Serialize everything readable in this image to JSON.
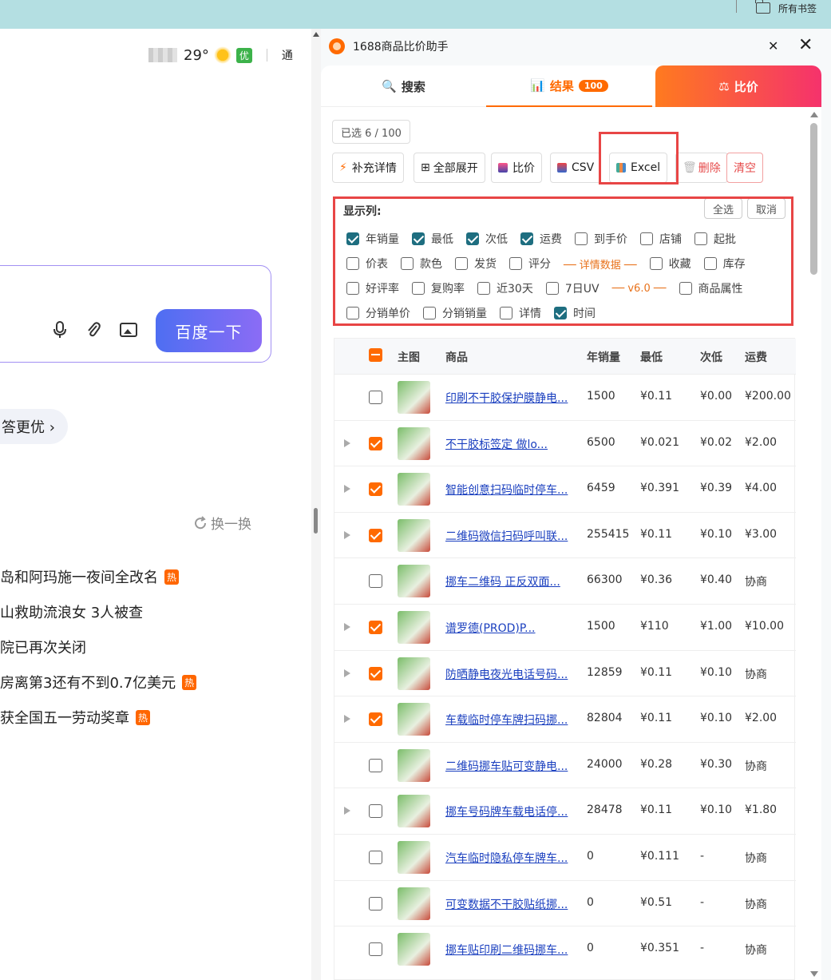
{
  "browser": {
    "bookmarks_label": "所有书签"
  },
  "baidu": {
    "temperature": "29°",
    "air_quality": "优",
    "top_right_text": "通",
    "search_button": "百度一下",
    "answer_chip": "答更优 ›",
    "refresh_label": "换一换",
    "hot_list": [
      {
        "text": "岛和阿玛施一夜间全改名",
        "hot": true
      },
      {
        "text": "山救助流浪女 3人被查",
        "hot": false
      },
      {
        "text": "院已再次关闭",
        "hot": false
      },
      {
        "text": "房离第3还有不到0.7亿美元",
        "hot": true
      },
      {
        "text": "获全国五一劳动奖章",
        "hot": true
      }
    ],
    "hot_badge": "热"
  },
  "panel": {
    "title": "1688商品比价助手",
    "tabs": {
      "search": "搜索",
      "result": "结果",
      "result_count": "100",
      "compare": "比价"
    },
    "selected_count": "已选 6 / 100",
    "toolbar": {
      "fill_details": "补充详情",
      "expand_all": "全部展开",
      "compare": "比价",
      "csv": "CSV",
      "excel": "Excel",
      "delete": "删除",
      "clear": "清空"
    },
    "columns": {
      "title": "显示列:",
      "select_all": "全选",
      "cancel": "取消",
      "row1": [
        {
          "label": "年销量",
          "checked": true
        },
        {
          "label": "最低",
          "checked": true
        },
        {
          "label": "次低",
          "checked": true
        },
        {
          "label": "运费",
          "checked": true
        },
        {
          "label": "到手价",
          "checked": false
        },
        {
          "label": "店铺",
          "checked": false
        },
        {
          "label": "起批",
          "checked": false
        }
      ],
      "row2": [
        {
          "label": "价表",
          "checked": false
        },
        {
          "label": "款色",
          "checked": false
        },
        {
          "label": "发货",
          "checked": false
        },
        {
          "label": "评分",
          "checked": false
        }
      ],
      "row2_sep": "── 详情数据 ──",
      "row2b": [
        {
          "label": "收藏",
          "checked": false
        },
        {
          "label": "库存",
          "checked": false
        }
      ],
      "row3": [
        {
          "label": "好评率",
          "checked": false
        },
        {
          "label": "复购率",
          "checked": false
        },
        {
          "label": "近30天",
          "checked": false
        },
        {
          "label": "7日UV",
          "checked": false
        }
      ],
      "row3_sep": "── v6.0 ──",
      "row3b": [
        {
          "label": "商品属性",
          "checked": false
        }
      ],
      "row4": [
        {
          "label": "分销单价",
          "checked": false
        },
        {
          "label": "分销销量",
          "checked": false
        },
        {
          "label": "详情",
          "checked": false
        },
        {
          "label": "时间",
          "checked": true
        }
      ]
    },
    "table": {
      "headers": {
        "image": "主图",
        "product": "商品",
        "sales": "年销量",
        "lowest": "最低",
        "second": "次低",
        "shipping": "运费"
      },
      "rows": [
        {
          "expand": false,
          "checked": false,
          "name": "印刷不干胶保护膜静电...",
          "sales": "1500",
          "lowest": "¥0.11",
          "second": "¥0.00",
          "shipping": "¥200.00"
        },
        {
          "expand": true,
          "checked": true,
          "name": "不干胶标签定 做lo...",
          "sales": "6500",
          "lowest": "¥0.021",
          "second": "¥0.02",
          "shipping": "¥2.00"
        },
        {
          "expand": true,
          "checked": true,
          "name": "智能创意扫码临时停车...",
          "sales": "6459",
          "lowest": "¥0.391",
          "second": "¥0.39",
          "shipping": "¥4.00"
        },
        {
          "expand": true,
          "checked": true,
          "name": "二维码微信扫码呼叫联...",
          "sales": "255415",
          "lowest": "¥0.11",
          "second": "¥0.10",
          "shipping": "¥3.00"
        },
        {
          "expand": false,
          "checked": false,
          "name": "挪车二维码 正反双面...",
          "sales": "66300",
          "lowest": "¥0.36",
          "second": "¥0.40",
          "shipping": "协商"
        },
        {
          "expand": true,
          "checked": true,
          "name": "谱罗德(PROD)P...",
          "sales": "1500",
          "lowest": "¥110",
          "second": "¥1.00",
          "shipping": "¥10.00"
        },
        {
          "expand": true,
          "checked": true,
          "name": "防晒静电夜光电话号码...",
          "sales": "12859",
          "lowest": "¥0.11",
          "second": "¥0.10",
          "shipping": "协商"
        },
        {
          "expand": true,
          "checked": true,
          "name": "车载临时停车牌扫码挪...",
          "sales": "82804",
          "lowest": "¥0.11",
          "second": "¥0.10",
          "shipping": "¥2.00"
        },
        {
          "expand": false,
          "checked": false,
          "name": "二维码挪车贴可变静电...",
          "sales": "24000",
          "lowest": "¥0.28",
          "second": "¥0.30",
          "shipping": "协商"
        },
        {
          "expand": true,
          "checked": false,
          "name": "挪车号码牌车载电话停...",
          "sales": "28478",
          "lowest": "¥0.11",
          "second": "¥0.10",
          "shipping": "¥1.80"
        },
        {
          "expand": false,
          "checked": false,
          "name": "汽车临时隐私停车牌车...",
          "sales": "0",
          "lowest": "¥0.111",
          "second": "-",
          "shipping": "协商"
        },
        {
          "expand": false,
          "checked": false,
          "name": "可变数据不干胶贴纸挪...",
          "sales": "0",
          "lowest": "¥0.51",
          "second": "-",
          "shipping": "协商"
        },
        {
          "expand": false,
          "checked": false,
          "name": "挪车贴印刷二维码挪车...",
          "sales": "0",
          "lowest": "¥0.351",
          "second": "-",
          "shipping": "协商"
        }
      ]
    }
  }
}
